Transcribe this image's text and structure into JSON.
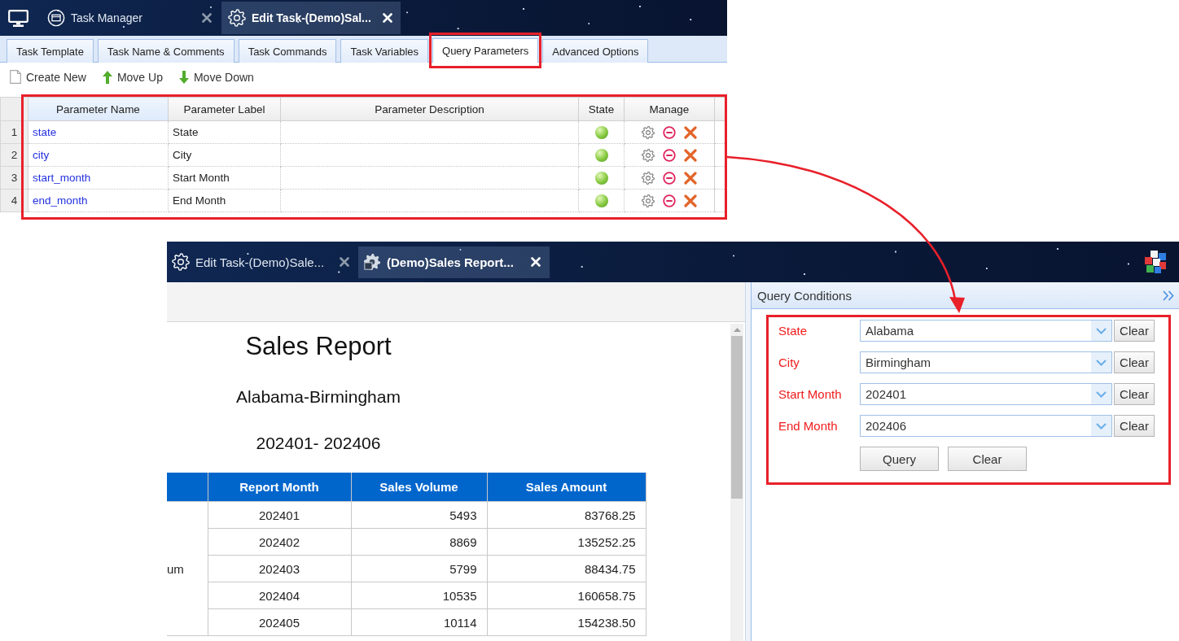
{
  "top_window": {
    "header_tabs": [
      {
        "label": "Task Manager",
        "kind": "manager",
        "selected": false
      },
      {
        "label": "Edit Task-(Demo)Sal...",
        "kind": "editor",
        "selected": true
      }
    ],
    "section_tabs": [
      {
        "label": "Task Template",
        "selected": false,
        "highlighted": false
      },
      {
        "label": "Task Name & Comments",
        "selected": false,
        "highlighted": false
      },
      {
        "label": "Task Commands",
        "selected": false,
        "highlighted": false
      },
      {
        "label": "Task Variables",
        "selected": false,
        "highlighted": false
      },
      {
        "label": "Query Parameters",
        "selected": true,
        "highlighted": true
      },
      {
        "label": "Advanced Options",
        "selected": false,
        "highlighted": false
      }
    ],
    "toolbar": [
      {
        "label": "Create New",
        "kind": "create"
      },
      {
        "label": "Move Up",
        "kind": "up"
      },
      {
        "label": "Move Down",
        "kind": "down"
      }
    ],
    "parameters_table": {
      "highlighted": true,
      "columns": [
        {
          "label": "Parameter Name",
          "selected": true
        },
        {
          "label": "Parameter Label",
          "selected": false
        },
        {
          "label": "Parameter Description",
          "selected": false
        },
        {
          "label": "State",
          "selected": false
        },
        {
          "label": "Manage",
          "selected": false
        }
      ],
      "rows": [
        {
          "number": "1",
          "name": "state",
          "label": "State",
          "enabled": true
        },
        {
          "number": "2",
          "name": "city",
          "label": "City",
          "enabled": true
        },
        {
          "number": "3",
          "name": "start_month",
          "label": "Start Month",
          "enabled": true
        },
        {
          "number": "4",
          "name": "end_month",
          "label": "End Month",
          "enabled": true
        }
      ]
    }
  },
  "bottom_window": {
    "header_tabs": [
      {
        "label": "Edit Task-(Demo)Sale...",
        "kind": "editor",
        "selected": false
      },
      {
        "label": "(Demo)Sales Report...",
        "kind": "report",
        "selected": true
      }
    ],
    "report": {
      "title": "Sales Report",
      "subtitle": "Alabama-Birmingham",
      "period": "202401- 202406",
      "table": {
        "column_1_cell": "um",
        "columns": [
          "Report Month",
          "Sales Volume",
          "Sales Amount"
        ],
        "rows": [
          [
            "202401",
            "5493",
            "83768.25"
          ],
          [
            "202402",
            "8869",
            "135252.25"
          ],
          [
            "202403",
            "5799",
            "88434.75"
          ],
          [
            "202404",
            "10535",
            "160658.75"
          ],
          [
            "202405",
            "10114",
            "154238.50"
          ]
        ]
      }
    },
    "query_panel": {
      "title": "Query Conditions",
      "highlighted": true,
      "fields": [
        {
          "label": "State",
          "value": "Alabama",
          "required": true,
          "clear_button": "Clear"
        },
        {
          "label": "City",
          "value": "Birmingham",
          "required": true,
          "clear_button": "Clear"
        },
        {
          "label": "Start Month",
          "value": "202401",
          "required": true,
          "clear_button": "Clear"
        },
        {
          "label": "End Month",
          "value": "202406",
          "required": true,
          "clear_button": "Clear"
        }
      ],
      "buttons": [
        "Query",
        "Clear"
      ]
    }
  }
}
